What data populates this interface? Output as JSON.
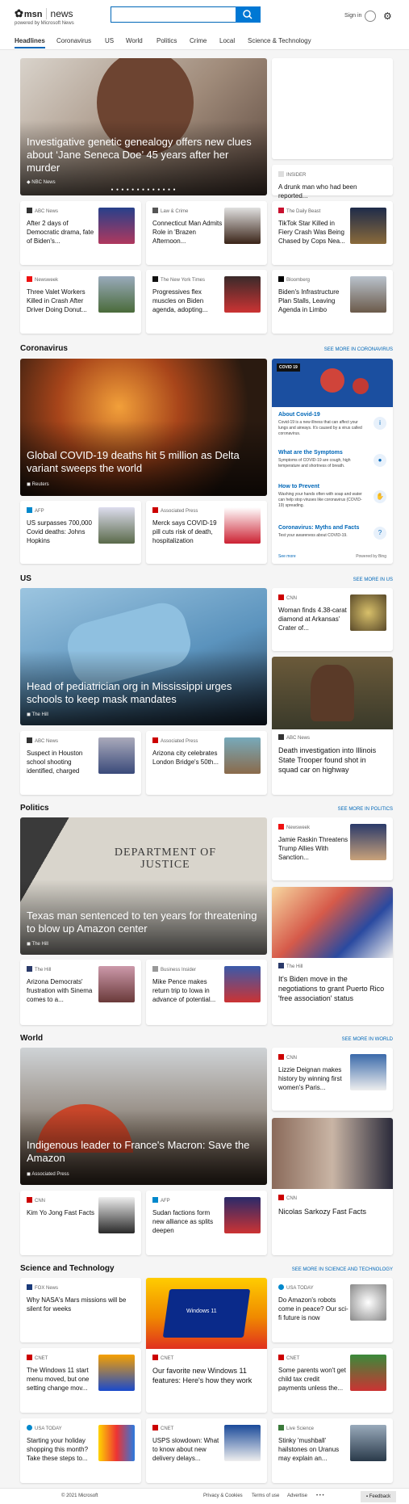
{
  "header": {
    "brand": "msn",
    "news": "news",
    "powered": "powered by Microsoft News",
    "search_placeholder": "",
    "signin": "Sign in",
    "search_icon": "search-icon",
    "gear_icon": "gear-icon"
  },
  "nav": [
    "Headlines",
    "Coronavirus",
    "US",
    "World",
    "Politics",
    "Crime",
    "Local",
    "Science & Technology"
  ],
  "top": {
    "hero": {
      "title": "Investigative genetic genealogy offers new clues about ‘Jane Seneca Doe’ 45 years after her murder",
      "source": "NBC News",
      "dots": "● ● ● ● ● ● ● ● ● ● ● ● ●"
    },
    "side": {
      "source": "INSIDER",
      "title": "A drunk man who had been reported..."
    },
    "cards": [
      {
        "source": "ABC News",
        "title": "After 2 days of Democratic drama, fate of Biden's..."
      },
      {
        "source": "Law & Crime",
        "title": "Connecticut Man Admits Role in 'Brazen Afternoon..."
      },
      {
        "source": "The Daily Beast",
        "title": "TikTok Star Killed in Fiery Crash Was Being Chased by Cops Nea..."
      },
      {
        "source": "Newsweek",
        "title": "Three Valet Workers Killed in Crash After Driver Doing Donut..."
      },
      {
        "source": "The New York Times",
        "title": "Progressives flex muscles on Biden agenda, adopting..."
      },
      {
        "source": "Bloomberg",
        "title": "Biden's Infrastructure Plan Stalls, Leaving Agenda in Limbo"
      }
    ]
  },
  "coronavirus": {
    "heading": "Coronavirus",
    "more": "SEE MORE IN CORONAVIRUS",
    "hero": {
      "title": "Global COVID-19 deaths hit 5 million as Delta variant sweeps the world",
      "source": "Reuters"
    },
    "cards": [
      {
        "source": "AFP",
        "title": "US surpasses 700,000 Covid deaths: Johns Hopkins"
      },
      {
        "source": "Associated Press",
        "title": "Merck says COVID-19 pill cuts risk of death, hospitalization"
      }
    ],
    "panel": {
      "badge": "COVID 19",
      "see_more": "See more",
      "powered": "Powered by Bing",
      "items": [
        {
          "title": "About Covid-19",
          "text": "Covid-19 is a new illness that can affect your lungs and airways. It's caused by a virus called coronavirus."
        },
        {
          "title": "What are the Symptoms",
          "text": "Symptoms of COVID-19 are cough, high temperature and shortness of breath."
        },
        {
          "title": "How to Prevent",
          "text": "Washing your hands often with soap and water can help stop viruses like coronavirus (COVID-19) spreading."
        },
        {
          "title": "Coronavirus: Myths and Facts",
          "text": "Test your awareness about COVID-19."
        }
      ]
    }
  },
  "us": {
    "heading": "US",
    "more": "SEE MORE IN US",
    "hero": {
      "title": "Head of pediatrician org in Mississippi urges schools to keep mask mandates",
      "source": "The Hill"
    },
    "side": {
      "source": "CNN",
      "title": "Woman finds 4.38-carat diamond at Arkansas' Crater of..."
    },
    "tall": {
      "source": "ABC News",
      "title": "Death investigation into Illinois State Trooper found shot in squad car on highway"
    },
    "cards": [
      {
        "source": "ABC News",
        "title": "Suspect in Houston school shooting identified, charged"
      },
      {
        "source": "Associated Press",
        "title": "Arizona city celebrates London Bridge's 50th..."
      }
    ]
  },
  "politics": {
    "heading": "Politics",
    "more": "SEE MORE IN POLITICS",
    "hero": {
      "title": "Texas man sentenced to ten years for threatening to blow up Amazon center",
      "source": "The Hill",
      "sign": "DEPARTMENT OF JUSTICE"
    },
    "side": {
      "source": "Newsweek",
      "title": "Jamie Raskin Threatens Trump Allies With Sanction..."
    },
    "tall": {
      "source": "The Hill",
      "title": "It's Biden move in the negotiations to grant Puerto Rico 'free association' status"
    },
    "cards": [
      {
        "source": "The Hill",
        "title": "Arizona Democrats' frustration with Sinema comes to a..."
      },
      {
        "source": "Business Insider",
        "title": "Mike Pence makes return trip to Iowa in advance of potential..."
      }
    ]
  },
  "world": {
    "heading": "World",
    "more": "SEE MORE IN WORLD",
    "hero": {
      "title": "Indigenous leader to France's Macron: Save the Amazon",
      "source": "Associated Press"
    },
    "side": {
      "source": "CNN",
      "title": "Lizzie Deignan makes history by winning first women's Paris..."
    },
    "tall": {
      "source": "CNN",
      "title": "Nicolas Sarkozy Fast Facts"
    },
    "cards": [
      {
        "source": "CNN",
        "title": "Kim Yo Jong Fast Facts"
      },
      {
        "source": "AFP",
        "title": "Sudan factions form new alliance as splits deepen"
      }
    ]
  },
  "science": {
    "heading": "Science and Technology",
    "more": "SEE MORE IN SCIENCE AND TECHNOLOGY",
    "cards": [
      {
        "source": "FOX News",
        "title": "Why NASA's Mars missions will be silent for weeks"
      },
      {
        "source": "USA TODAY",
        "title": "Do Amazon's robots come in peace? Our sci-fi future is now"
      },
      {
        "source": "CNET",
        "title": "The Windows 11 start menu moved, but one setting change mov..."
      },
      {
        "source": "CNET",
        "title": "Some parents won't get child tax credit payments unless the..."
      },
      {
        "source": "USA TODAY",
        "title": "Starting your holiday shopping this month? Take these steps to..."
      },
      {
        "source": "CNET",
        "title": "USPS slowdown: What to know about new delivery delays..."
      },
      {
        "source": "Live Science",
        "title": "Stinky 'mushball' hailstones on Uranus may explain an..."
      }
    ],
    "tall": {
      "source": "CNET",
      "title": "Our favorite new Windows 11 features: Here's how they work",
      "screen": "Windows 11"
    }
  },
  "footer": {
    "copyright": "© 2021 Microsoft",
    "privacy": "Privacy & Cookies",
    "terms": "Terms of use",
    "advertise": "Advertise",
    "ellipsis": "• • •",
    "feedback": "Feedback"
  }
}
